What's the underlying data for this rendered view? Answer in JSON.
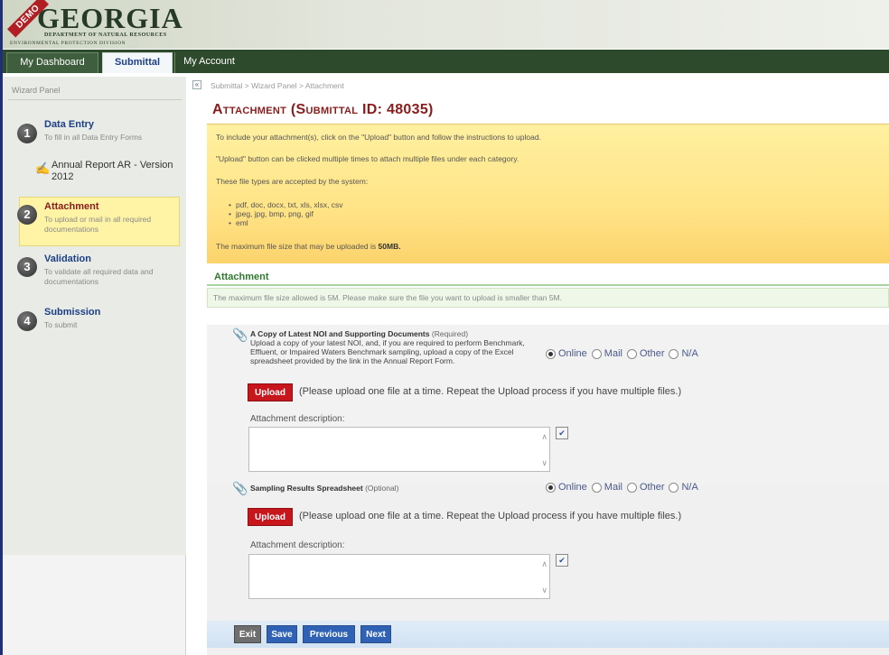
{
  "header": {
    "demo_badge": "DEMO",
    "logo_title": "GEORGIA",
    "logo_sub1": "DEPARTMENT OF NATURAL RESOURCES",
    "logo_sub2": "ENVIRONMENTAL PROTECTION DIVISION"
  },
  "nav": {
    "tabs": [
      "My Dashboard",
      "Submittal",
      "My Account"
    ],
    "active_tab": "Submittal"
  },
  "sidebar": {
    "title": "Wizard Panel",
    "steps": [
      {
        "num": "1",
        "title": "Data Entry",
        "desc": "To fill in all Data Entry Forms"
      },
      {
        "num": "2",
        "title": "Attachment",
        "desc": "To upload or mail in all required documentations"
      },
      {
        "num": "3",
        "title": "Validation",
        "desc": "To validate all required data and documentations"
      },
      {
        "num": "4",
        "title": "Submission",
        "desc": "To submit"
      }
    ],
    "sub_item": "Annual Report AR - Version 2012"
  },
  "main": {
    "breadcrumb": "Submittal > Wizard Panel > Attachment",
    "page_title": "Attachment (Submittal ID: 48035)",
    "info": {
      "line1": "To include your attachment(s), click on the \"Upload\" button and follow the instructions to upload.",
      "line2": "\"Upload\" button can be clicked multiple times to attach multiple files under each category.",
      "line3": "These file types are accepted by the system:",
      "types": [
        "pdf, doc, docx, txt, xls, xlsx, csv",
        "jpeg, jpg, bmp, png, gif",
        "eml"
      ],
      "max_prefix": "The maximum file size that may be uploaded is ",
      "max_value": "50MB."
    },
    "section_title": "Attachment",
    "section_note": "The maximum file size allowed is 5M. Please make sure the file you want to upload is smaller than 5M.",
    "attachments": [
      {
        "title": "A Copy of Latest NOI and Supporting Documents",
        "req": "(Required)",
        "desc": "Upload a copy of your latest NOI, and, if you are required to perform Benchmark, Effluent, or Impaired Waters Benchmark sampling, upload a copy of the Excel spreadsheet provided by the link in the Annual Report Form.",
        "options": [
          "Online",
          "Mail",
          "Other",
          "N/A"
        ],
        "selected": "Online",
        "upload_label": "Upload",
        "upload_hint": "(Please upload one file at a time. Repeat the Upload process if you have multiple files.)",
        "desc_label": "Attachment description:"
      },
      {
        "title": "Sampling Results Spreadsheet",
        "req": "(Optional)",
        "desc": "",
        "options": [
          "Online",
          "Mail",
          "Other",
          "N/A"
        ],
        "selected": "Online",
        "upload_label": "Upload",
        "upload_hint": "(Please upload one file at a time. Repeat the Upload process if you have multiple files.)",
        "desc_label": "Attachment description:"
      }
    ]
  },
  "footer": {
    "exit": "Exit",
    "save": "Save",
    "previous": "Previous",
    "next": "Next"
  },
  "colors": {
    "nav_bg": "#2e4a2c",
    "title": "#8a1c1c",
    "upload": "#c8161d",
    "footer_btn": "#2f62b5"
  }
}
